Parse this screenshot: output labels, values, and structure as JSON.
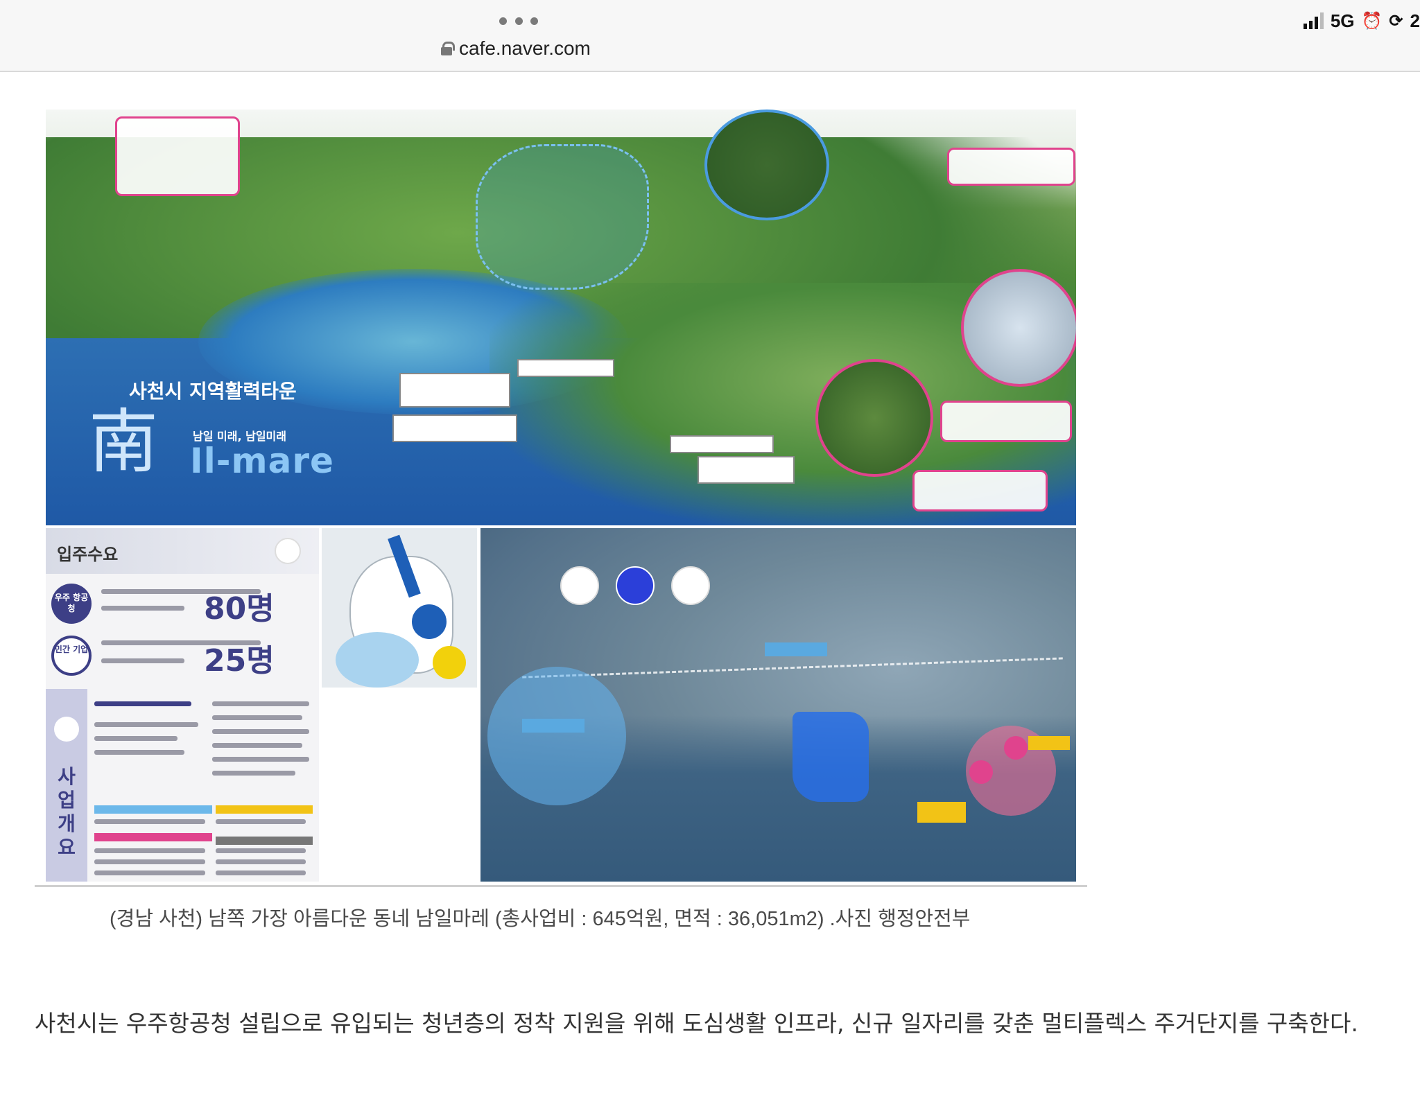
{
  "browser": {
    "url": "cafe.naver.com",
    "status": {
      "network": "5G",
      "battery": "2"
    }
  },
  "figure": {
    "title": "사천시 지역활력타운",
    "hanja": "南",
    "tagline": "남일 미래, 남일미래",
    "logo": "Il-mare",
    "demand_title": "입주수요",
    "badge_space": "우주 항공청",
    "badge_private": "민간 기업",
    "count_space": "80명",
    "count_private": "25명",
    "overview_label": "사업개요"
  },
  "caption": "(경남 사천) 남쪽 가장 아름다운 동네 남일마레 (총사업비 : 645억원, 면적 : 36,051m2) .사진 행정안전부",
  "article": {
    "paragraph": "사천시는 우주항공청 설립으로 유입되는 청년층의 정착 지원을 위해 도심생활 인프라, 신규 일자리를 갖춘 멀티플렉스 주거단지를 구축한다."
  },
  "colors": {
    "accent_pink": "#e0438d",
    "accent_navy": "#3d3f86",
    "sea_blue": "#2b62a8"
  }
}
